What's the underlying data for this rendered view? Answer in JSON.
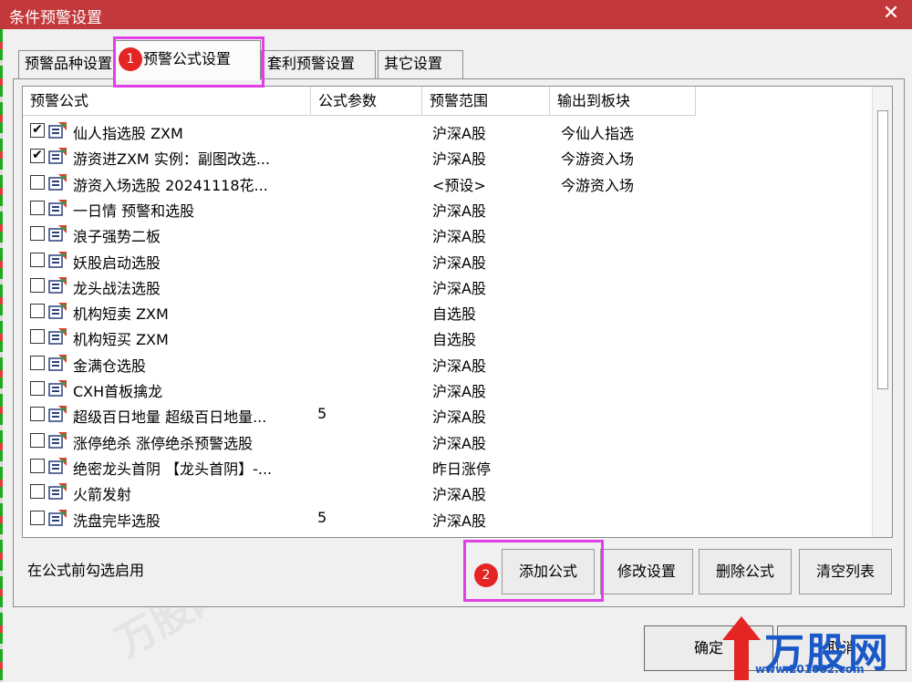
{
  "window": {
    "title": "条件预警设置"
  },
  "tabs": [
    {
      "label": "预警品种设置"
    },
    {
      "label": "预警公式设置"
    },
    {
      "label": "套利预警设置"
    },
    {
      "label": "其它设置"
    }
  ],
  "columns": [
    "预警公式",
    "公式参数",
    "预警范围",
    "输出到板块"
  ],
  "rows": [
    {
      "checked": true,
      "name": "仙人指选股 ZXM",
      "param": "",
      "range": "沪深A股",
      "output": "今仙人指选"
    },
    {
      "checked": true,
      "name": "游资进ZXM 实例：副图改选...",
      "param": "",
      "range": "沪深A股",
      "output": "今游资入场"
    },
    {
      "checked": false,
      "name": "游资入场选股 20241118花...",
      "param": "",
      "range": "<预设>",
      "output": "今游资入场"
    },
    {
      "checked": false,
      "name": "一日情 预警和选股",
      "param": "",
      "range": "沪深A股",
      "output": ""
    },
    {
      "checked": false,
      "name": "浪子强势二板",
      "param": "",
      "range": "沪深A股",
      "output": ""
    },
    {
      "checked": false,
      "name": "妖股启动选股",
      "param": "",
      "range": "沪深A股",
      "output": ""
    },
    {
      "checked": false,
      "name": "龙头战法选股",
      "param": "",
      "range": "沪深A股",
      "output": ""
    },
    {
      "checked": false,
      "name": "机构短卖 ZXM",
      "param": "",
      "range": "自选股",
      "output": ""
    },
    {
      "checked": false,
      "name": "机构短买 ZXM",
      "param": "",
      "range": "自选股",
      "output": ""
    },
    {
      "checked": false,
      "name": "金满仓选股",
      "param": "",
      "range": "沪深A股",
      "output": ""
    },
    {
      "checked": false,
      "name": "CXH首板擒龙",
      "param": "",
      "range": "沪深A股",
      "output": ""
    },
    {
      "checked": false,
      "name": "超级百日地量 超级百日地量...",
      "param": "5",
      "range": "沪深A股",
      "output": ""
    },
    {
      "checked": false,
      "name": "涨停绝杀 涨停绝杀预警选股",
      "param": "",
      "range": "沪深A股",
      "output": ""
    },
    {
      "checked": false,
      "name": "绝密龙头首阴 【龙头首阴】-...",
      "param": "",
      "range": "昨日涨停",
      "output": ""
    },
    {
      "checked": false,
      "name": "火箭发射",
      "param": "",
      "range": "沪深A股",
      "output": ""
    },
    {
      "checked": false,
      "name": "洗盘完毕选股",
      "param": "5",
      "range": "沪深A股",
      "output": ""
    }
  ],
  "hint": "在公式前勾选启用",
  "buttons": {
    "add": "添加公式",
    "modify": "修改设置",
    "delete": "删除公式",
    "clear": "清空列表",
    "ok": "确定",
    "cancel": "取消"
  },
  "badges": [
    "1",
    "2"
  ],
  "branding": {
    "logo": "万股网",
    "url": "www.201082.com"
  },
  "icons": {
    "close": "close-icon",
    "formula": "formula-icon",
    "checkbox": "checkbox-icon"
  },
  "colors": {
    "titlebar": "#c2383b",
    "highlight": "#e040e6",
    "badge": "#e52424",
    "logo": "#1a58c8"
  }
}
